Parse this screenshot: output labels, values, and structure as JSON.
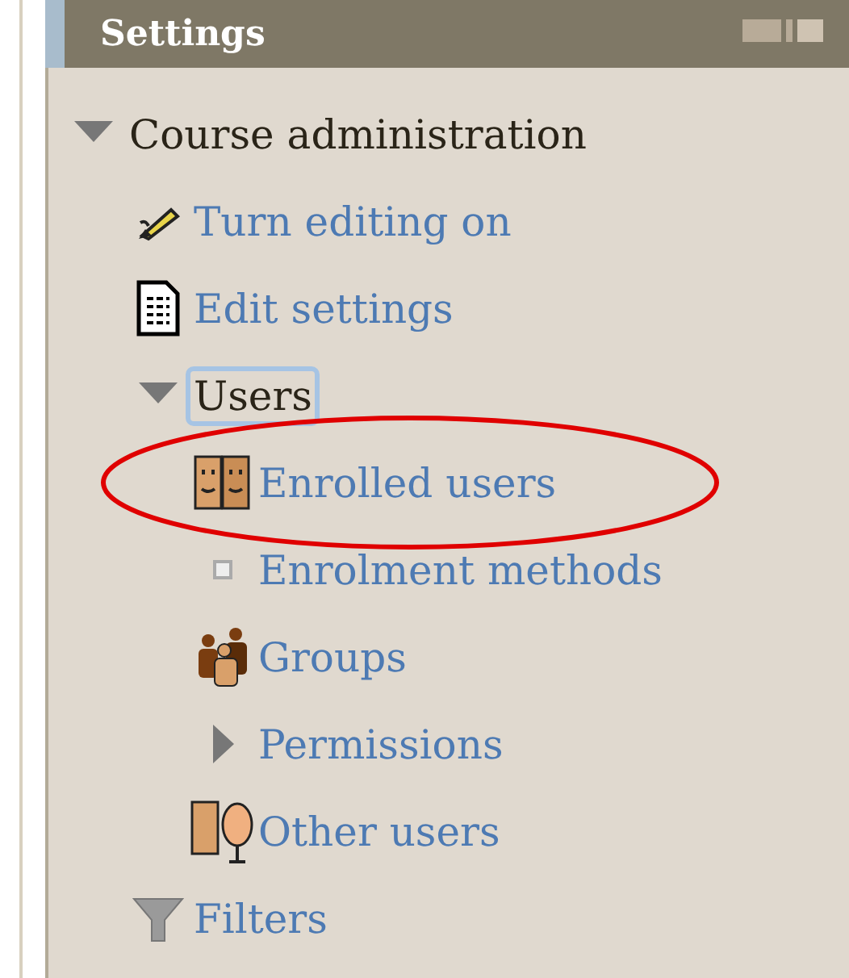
{
  "panel": {
    "title": "Settings"
  },
  "tree": [
    {
      "label": "Course administration",
      "kind": "branch",
      "link": false,
      "expanded": true,
      "focused": false,
      "circled": false,
      "children": [
        {
          "label": "Turn editing on",
          "kind": "pencil",
          "link": true,
          "focused": false,
          "circled": false
        },
        {
          "label": "Edit settings",
          "kind": "document",
          "link": true,
          "focused": false,
          "circled": false
        },
        {
          "label": "Users",
          "kind": "branch",
          "link": false,
          "expanded": true,
          "focused": true,
          "circled": false,
          "children": [
            {
              "label": "Enrolled users",
              "kind": "faces",
              "link": true,
              "focused": false,
              "circled": true
            },
            {
              "label": "Enrolment methods",
              "kind": "bullet",
              "link": true,
              "focused": false,
              "circled": false
            },
            {
              "label": "Groups",
              "kind": "people",
              "link": true,
              "focused": false,
              "circled": false
            },
            {
              "label": "Permissions",
              "kind": "branch",
              "link": true,
              "expanded": false,
              "focused": false,
              "circled": false
            },
            {
              "label": "Other users",
              "kind": "faces2",
              "link": true,
              "focused": false,
              "circled": false
            }
          ]
        },
        {
          "label": "Filters",
          "kind": "funnel",
          "link": true,
          "focused": false,
          "circled": false
        }
      ]
    }
  ]
}
